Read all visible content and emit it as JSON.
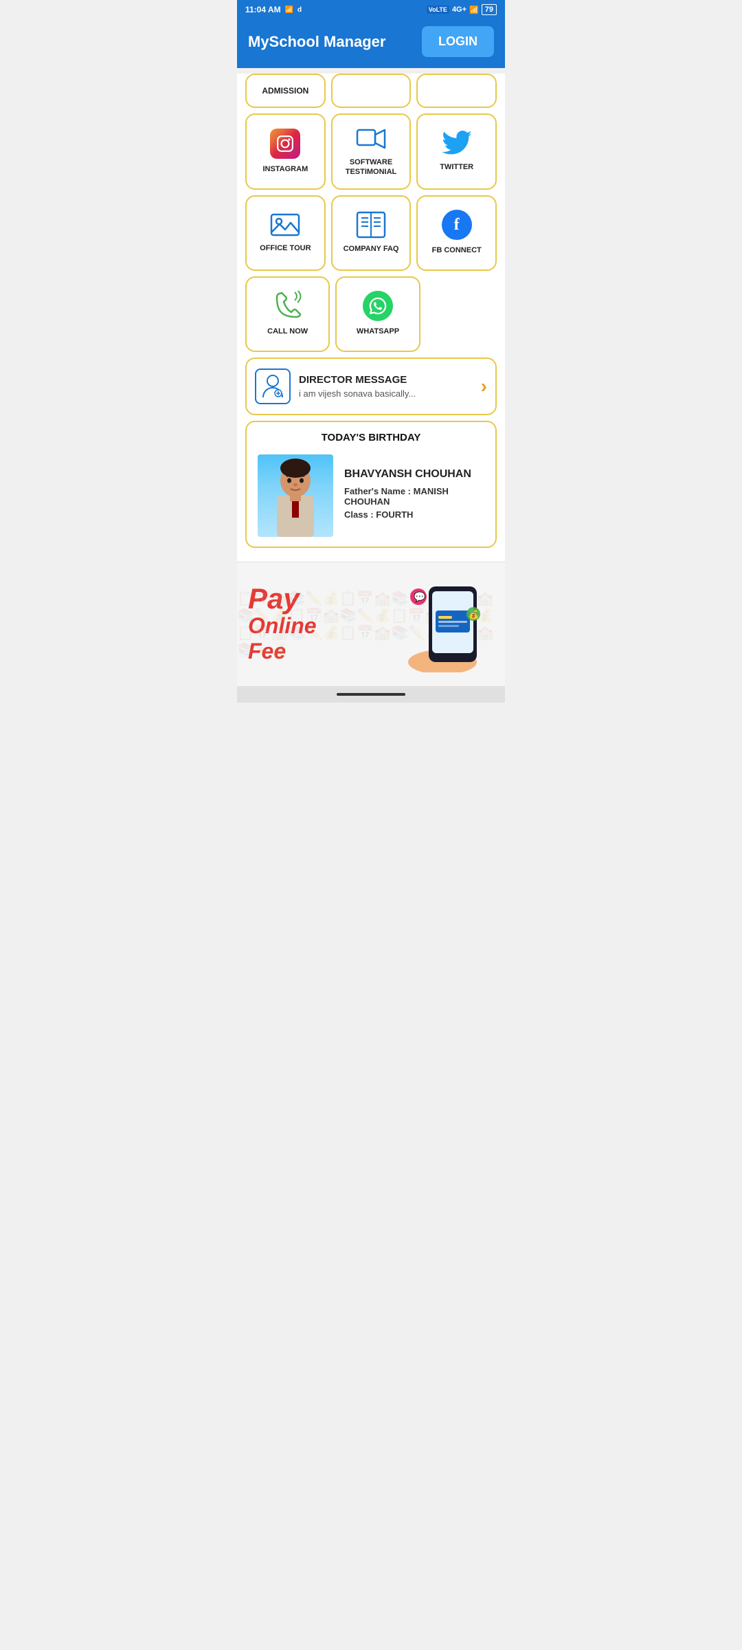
{
  "statusBar": {
    "time": "11:04 AM",
    "battery": "79",
    "network": "4G+"
  },
  "header": {
    "title": "MySchool Manager",
    "loginLabel": "LOGIN"
  },
  "admissionRow": {
    "cell1": "ADMISSION",
    "cell2": "",
    "cell3": ""
  },
  "grid": {
    "row1": [
      {
        "id": "instagram",
        "label": "INSTAGRAM",
        "icon": "instagram"
      },
      {
        "id": "software-testimonial",
        "label": "SOFTWARE\nTESTIMONIAL",
        "icon": "video"
      },
      {
        "id": "twitter",
        "label": "TWITTER",
        "icon": "twitter"
      }
    ],
    "row2": [
      {
        "id": "office-tour",
        "label": "OFFICE TOUR",
        "icon": "image"
      },
      {
        "id": "company-faq",
        "label": "COMPANY FAQ",
        "icon": "book"
      },
      {
        "id": "fb-connect",
        "label": "FB CONNECT",
        "icon": "facebook"
      }
    ],
    "row3": [
      {
        "id": "call-now",
        "label": "CALL NOW",
        "icon": "phone"
      },
      {
        "id": "whatsapp",
        "label": "WHATSAPP",
        "icon": "whatsapp"
      }
    ]
  },
  "directorMessage": {
    "title": "DIRECTOR MESSAGE",
    "preview": "i am vijesh sonava basically..."
  },
  "birthdaySection": {
    "title": "TODAY'S BIRTHDAY",
    "studentName": "BHAVYANSH CHOUHAN",
    "fatherLabel": "Father's Name :",
    "fatherName": "MANISH CHOUHAN",
    "classLabel": "Class :",
    "className": "FOURTH"
  },
  "payBanner": {
    "line1": "Pay",
    "line2": "Online Fee"
  }
}
